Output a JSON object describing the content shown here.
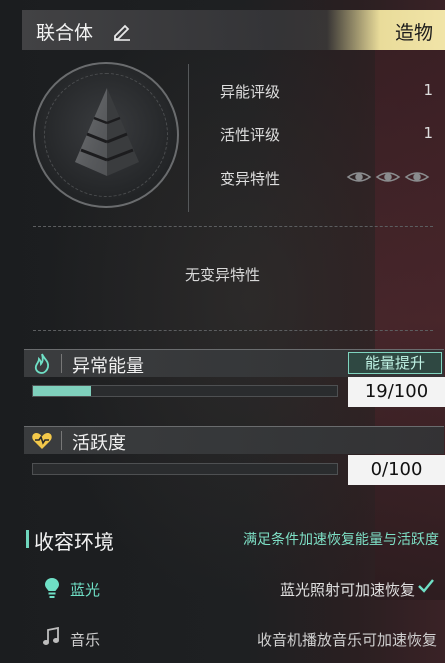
{
  "header": {
    "title": "联合体",
    "tag": "造物"
  },
  "stats": {
    "items": [
      {
        "label": "异能评级",
        "value": "1"
      },
      {
        "label": "活性评级",
        "value": "1"
      },
      {
        "label": "变异特性"
      }
    ],
    "no_trait_text": "无变异特性"
  },
  "energy": {
    "title": "异常能量",
    "button_label": "能量提升",
    "value_text": "19/100",
    "fraction": 0.19,
    "fill_color": "#7fd0bc"
  },
  "activity": {
    "title": "活跃度",
    "value_text": "0/100",
    "fraction": 0.0
  },
  "environment": {
    "title": "收容环境",
    "hint": "满足条件加速恢复能量与活跃度",
    "items": [
      {
        "name": "蓝光",
        "desc": "蓝光照射可加速恢复",
        "satisfied": true,
        "color": "#6fe0c6"
      },
      {
        "name": "音乐",
        "desc": "收音机播放音乐可加速恢复",
        "satisfied": false,
        "color": "#bdbdbd"
      }
    ]
  },
  "colors": {
    "accent": "#7fd0bc",
    "tag_bg": "#efe2a4"
  }
}
